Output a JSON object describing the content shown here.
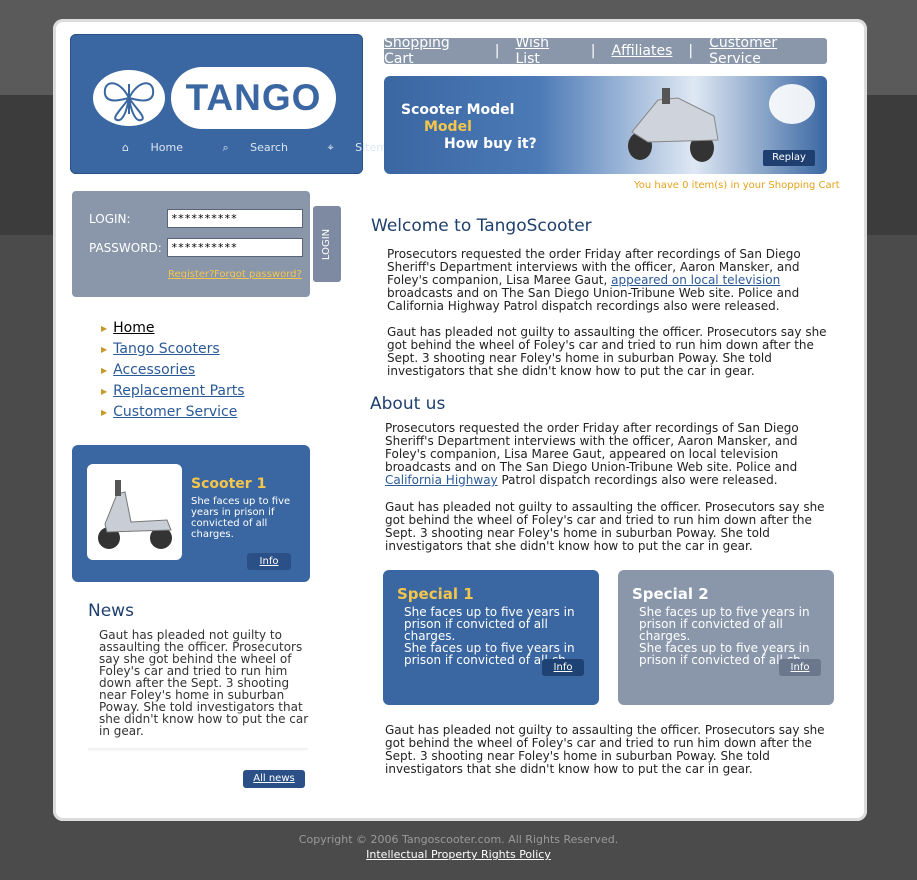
{
  "brand": {
    "name": "TANGO"
  },
  "header_links": [
    {
      "icon": "home-icon",
      "label": "Home"
    },
    {
      "icon": "search-icon",
      "label": "Search"
    },
    {
      "icon": "sitemap-icon",
      "label": "Sitemap"
    }
  ],
  "top_nav": [
    "Shopping Cart",
    "Wish List",
    "Affiliates",
    "Customer Service"
  ],
  "banner": {
    "line1": "Scooter Model",
    "line2": "Model",
    "line3": "How buy it?",
    "replay": "Replay"
  },
  "cart_info": "You have 0 item(s) in your Shopping Cart",
  "login": {
    "login_label": "LOGIN:",
    "password_label": "PASSWORD:",
    "login_value": "**********",
    "password_value": "**********",
    "register": "Register?",
    "forgot": "Forgot password?",
    "button": "LOGIN"
  },
  "menu": [
    "Home",
    "Tango Scooters",
    "Accessories",
    "Replacement Parts",
    "Customer Service"
  ],
  "scooter": {
    "title": "Scooter 1",
    "text": "She faces up to five years in prison if convicted of all charges.",
    "info": "Info"
  },
  "news": {
    "title": "News",
    "text": "Gaut has pleaded not guilty to assaulting the officer. Prosecutors say she got behind the wheel of Foley's car and tried to run him down after the Sept. 3 shooting near Foley's home in suburban Poway. She told investigators that she didn't know how to put the car in gear.",
    "all_news": "All news"
  },
  "welcome": {
    "title": "Welcome to TangoScooter",
    "p1_before": "Prosecutors requested the order Friday after recordings of San Diego Sheriff's Department interviews with the officer, Aaron Mansker, and Foley's companion, Lisa Maree Gaut, ",
    "p1_link": "appeared on local television",
    "p1_after": " broadcasts and on The San Diego Union-Tribune Web site. Police and California Highway Patrol dispatch recordings also were released.",
    "p2": "Gaut has pleaded not guilty to assaulting the officer. Prosecutors say she got behind the wheel of Foley's car and tried to run him down after the Sept. 3 shooting near Foley's home in suburban Poway. She told investigators that she didn't know how to put the car in gear."
  },
  "about": {
    "title": "About us",
    "p1_before": "Prosecutors requested the order Friday after recordings of San Diego Sheriff's Department interviews with the officer, Aaron Mansker, and Foley's companion, Lisa Maree Gaut, appeared on local television broadcasts and on The San Diego Union-Tribune Web site. Police and ",
    "p1_link": "California Highway",
    "p1_after": " Patrol dispatch recordings also were released.",
    "p2": "Gaut has pleaded not guilty to assaulting the officer. Prosecutors say she got behind the wheel of Foley's car and tried to run him down after the Sept. 3 shooting near Foley's home in suburban Poway. She told investigators that she didn't know how to put the car in gear."
  },
  "specials": [
    {
      "title": "Special 1",
      "text1": "She faces up to five years in prison if convicted of all charges.",
      "text2": "She faces up to five years in prison if convicted of all ch",
      "info": "Info"
    },
    {
      "title": "Special 2",
      "text1": "She faces up to five years in prison if convicted of all charges.",
      "text2": "She faces up to five years in prison if convicted of all ch",
      "info": "Info"
    }
  ],
  "bottom_text": "Gaut has pleaded not guilty to assaulting the officer. Prosecutors say she got behind the wheel of Foley's car and tried to run him down after the Sept. 3 shooting near Foley's home in suburban Poway. She told investigators that she didn't know how to put the car in gear.",
  "footer": {
    "copyright": "Copyright © 2006 Tangoscooter.com. All Rights Reserved.",
    "policy": "Intellectual Property Rights Policy"
  }
}
